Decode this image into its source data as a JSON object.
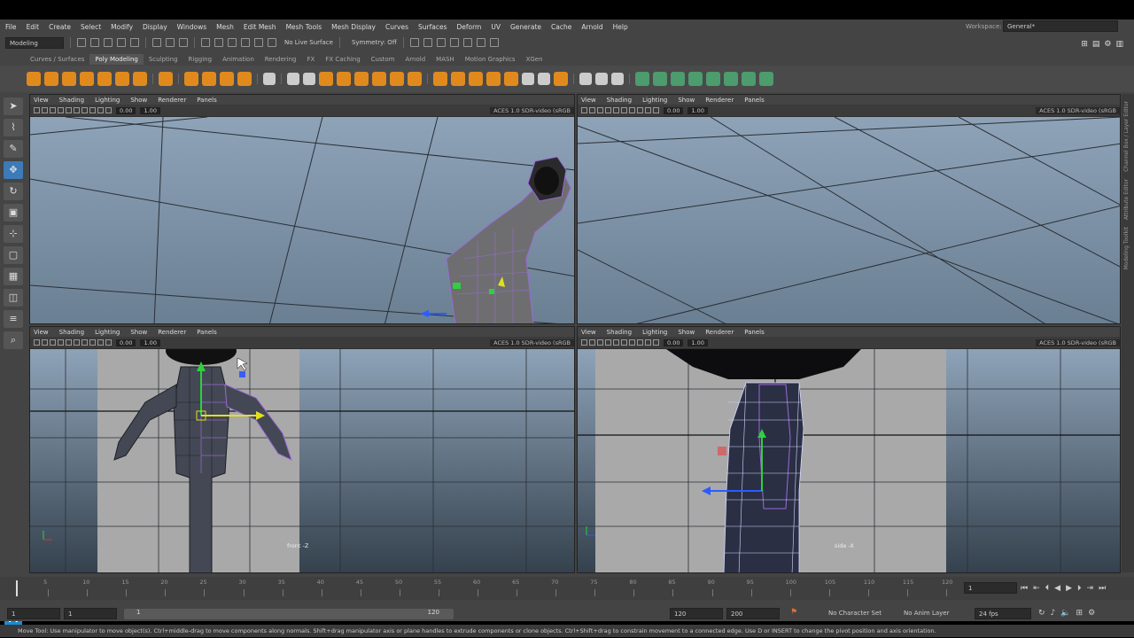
{
  "menubar": [
    "File",
    "Edit",
    "Create",
    "Select",
    "Modify",
    "Display",
    "Windows",
    "Mesh",
    "Edit Mesh",
    "Mesh Tools",
    "Mesh Display",
    "Curves",
    "Surfaces",
    "Deform",
    "UV",
    "Generate",
    "Cache",
    "Arnold",
    "Help"
  ],
  "workspace": {
    "label": "Workspace:",
    "value": "General*"
  },
  "statusline": {
    "mode": "Modeling",
    "live_surface": "No Live Surface",
    "symmetry": "Symmetry: Off"
  },
  "shelf_tabs": [
    "Curves / Surfaces",
    "Poly Modeling",
    "Sculpting",
    "Rigging",
    "Animation",
    "Rendering",
    "FX",
    "FX Caching",
    "Custom",
    "Arnold",
    "MASH",
    "Motion Graphics",
    "XGen"
  ],
  "active_shelf": "Poly Modeling",
  "viewport": {
    "menus": [
      "View",
      "Shading",
      "Lighting",
      "Show",
      "Renderer",
      "Panels"
    ],
    "exposure": "0.00",
    "gamma": "1.00",
    "color_space": "ACES 1.0 SDR-video (sRGB"
  },
  "cameras": {
    "front": "front -Z",
    "side": "side -X"
  },
  "timeline": {
    "ticks": [
      "5",
      "10",
      "15",
      "20",
      "25",
      "30",
      "35",
      "40",
      "45",
      "50",
      "55",
      "60",
      "65",
      "70",
      "75",
      "80",
      "85",
      "90",
      "95",
      "100",
      "105",
      "110",
      "115",
      "120"
    ],
    "current_frame": "1"
  },
  "range": {
    "start": "1",
    "start_inner": "1",
    "slider_start": "1",
    "slider_end": "120",
    "end_inner": "120",
    "end": "200",
    "character_set": "No Character Set",
    "anim_layer": "No Anim Layer",
    "fps": "24 fps"
  },
  "right_panels": [
    "Channel Box / Layer Editor",
    "Attribute Editor",
    "Modeling Toolkit"
  ],
  "helpline": "Move Tool: Use manipulator to move object(s). Ctrl+middle-drag to move components along normals. Shift+drag manipulator axis or plane handles to extrude components or clone objects. Ctrl+Shift+drag to constrain movement to a connected edge. Use D or INSERT to change the pivot position and axis orientation.",
  "logo": "M"
}
